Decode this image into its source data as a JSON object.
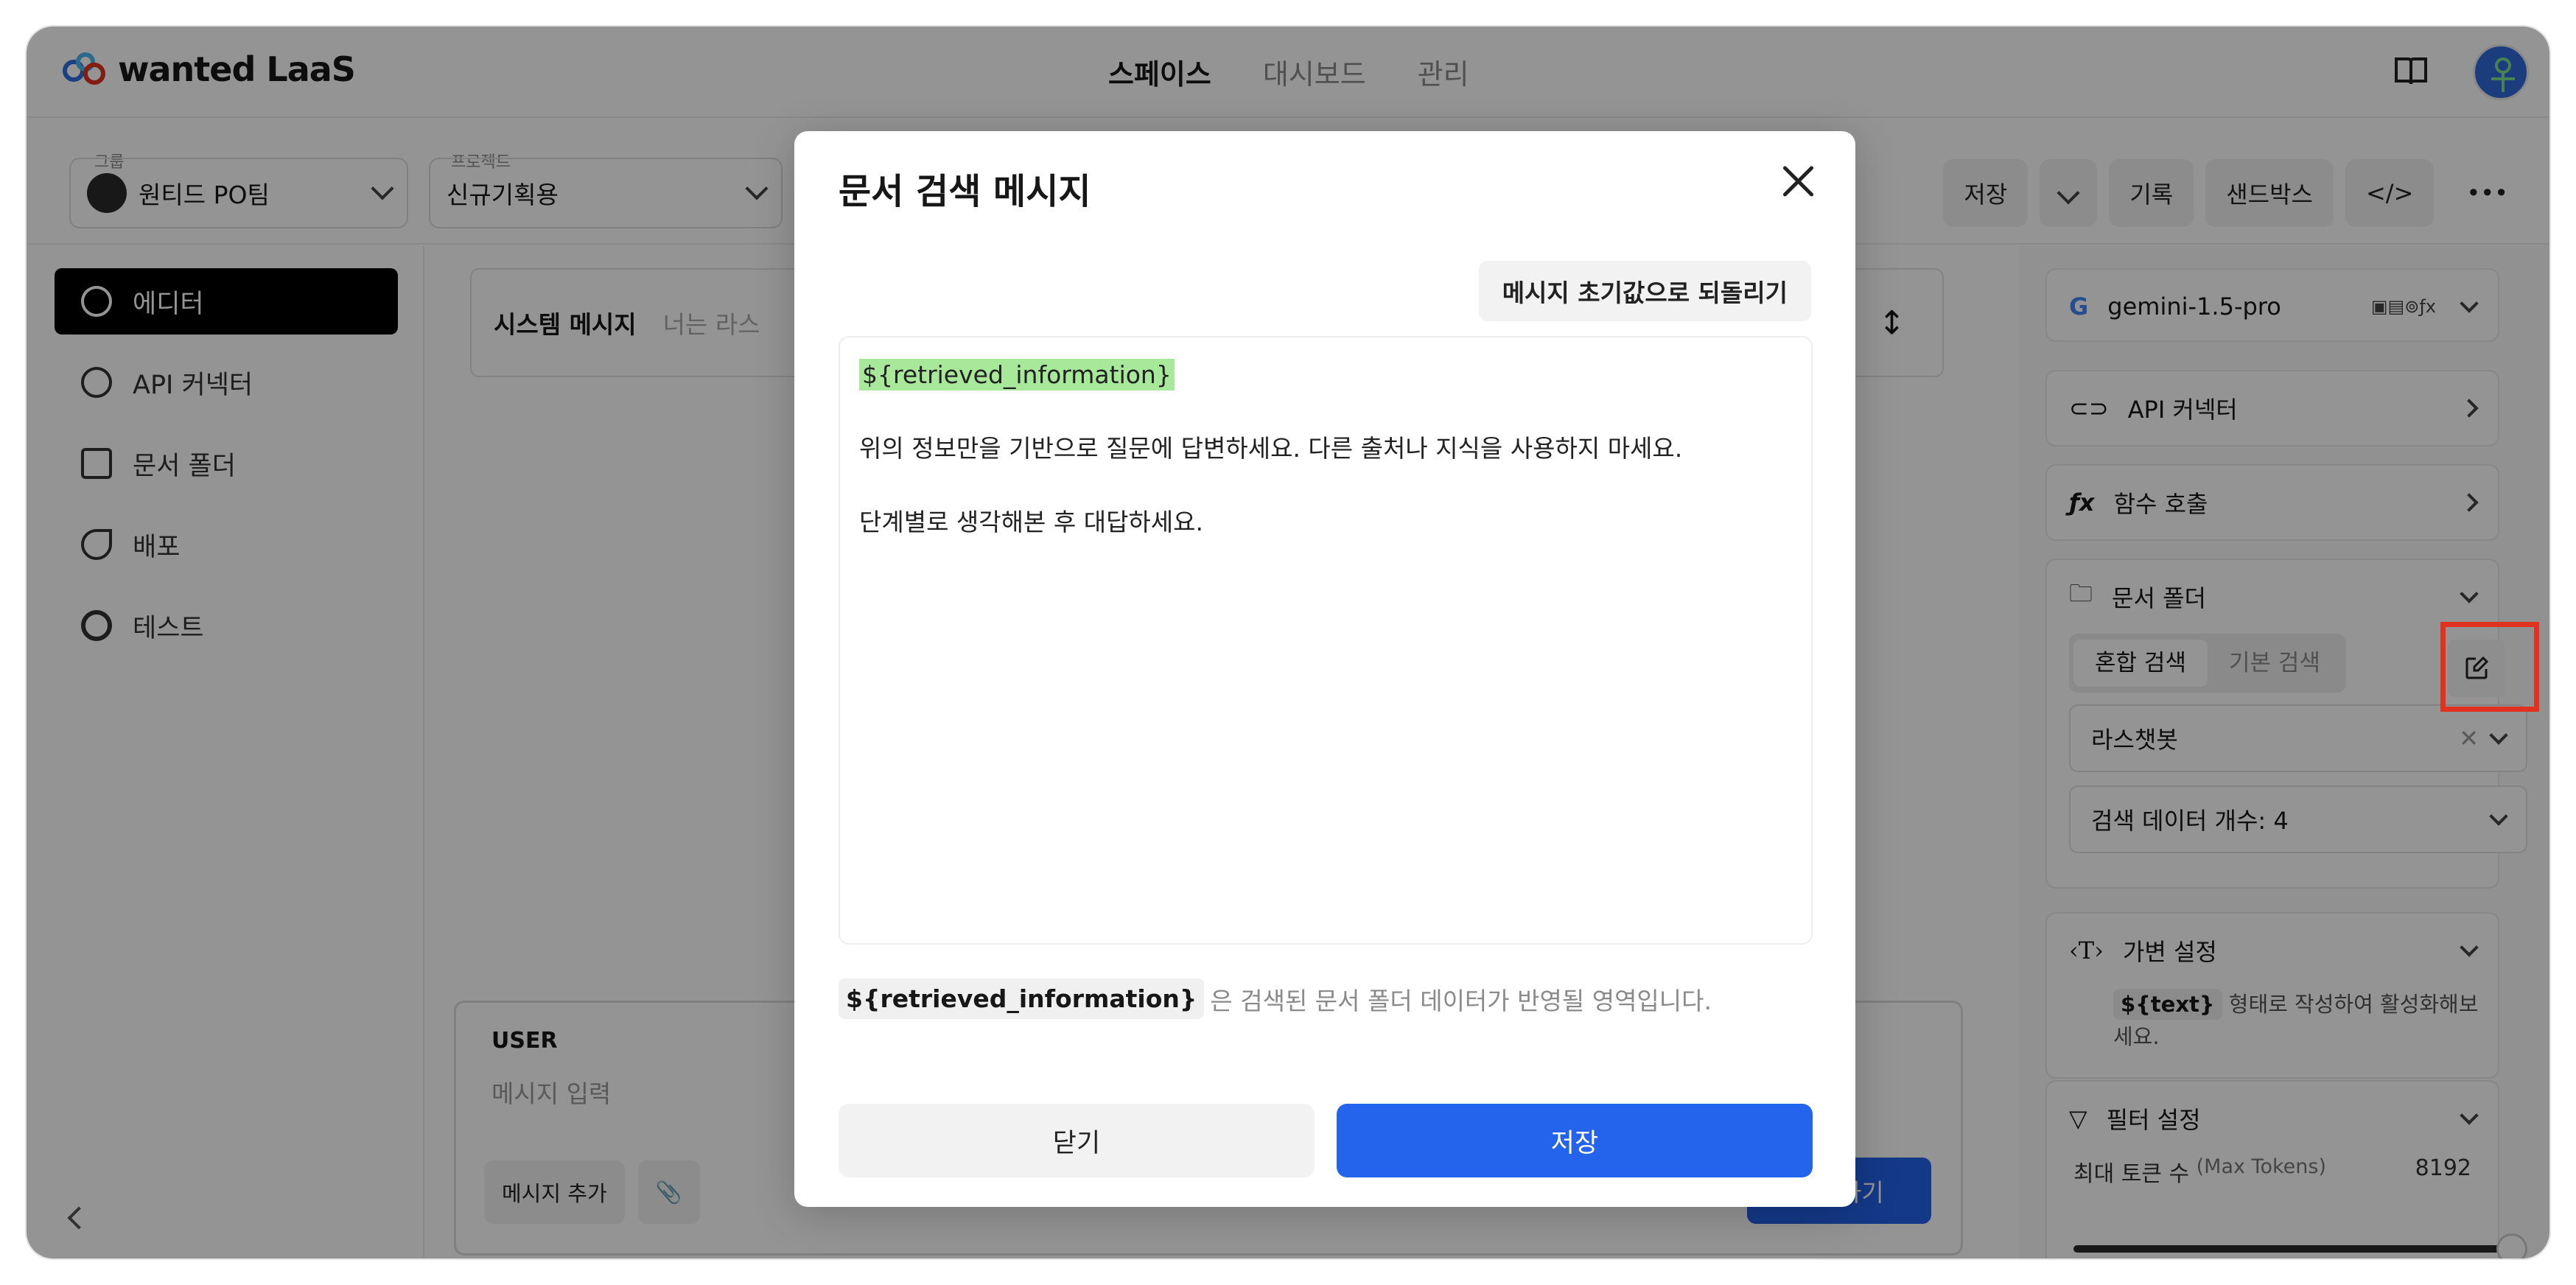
{
  "app": {
    "logo_text": "wanted LaaS"
  },
  "nav": {
    "items": [
      "스페이스",
      "대시보드",
      "관리"
    ],
    "active": 0
  },
  "subbar": {
    "group_label": "그룹",
    "group_value": "원티드 PO팀",
    "project_label": "프로젝트",
    "project_value": "신규기획용",
    "save": "저장",
    "history": "기록",
    "sandbox": "샌드박스"
  },
  "sidebar": {
    "items": [
      {
        "label": "에디터",
        "icon": "chat-icon"
      },
      {
        "label": "API 커넥터",
        "icon": "link-icon"
      },
      {
        "label": "문서 폴더",
        "icon": "folder-search-icon"
      },
      {
        "label": "배포",
        "icon": "rocket-icon"
      },
      {
        "label": "테스트",
        "icon": "target-icon"
      }
    ]
  },
  "editor": {
    "system_label": "시스템 메시지",
    "system_placeholder": "너는 라스",
    "user_title": "USER",
    "user_placeholder": "메시지 입력",
    "add_message": "메시지 추가",
    "submit": "제출하기"
  },
  "right_panel": {
    "model": "gemini-1.5-pro",
    "api_connector": "API 커넥터",
    "function_call": "함수 호출",
    "doc_folder": "문서 폴더",
    "search_modes": [
      "혼합 검색",
      "기본 검색"
    ],
    "folder_select": "라스챗봇",
    "search_count": "검색 데이터 개수: 4",
    "variable_settings": "가변 설정",
    "variable_tag": "${text}",
    "variable_hint": "형태로 작성하여 활성화해보세요.",
    "filter_settings": "필터 설정",
    "max_tokens_label": "최대 토큰 수",
    "max_tokens_en": "(Max Tokens)",
    "max_tokens_value": "8192"
  },
  "modal": {
    "title": "문서 검색 메시지",
    "reset": "메시지 초기값으로 되돌리기",
    "var_line": "${retrieved_information}",
    "line1": "위의 정보만을 기반으로 질문에 답변하세요. 다른 출처나 지식을 사용하지 마세요.",
    "line2": "단계별로 생각해본 후 대답하세요.",
    "hint_tag": "${retrieved_information}",
    "hint_text": "은 검색된 문서 폴더 데이터가 반영될 영역입니다.",
    "close": "닫기",
    "save": "저장"
  },
  "colors": {
    "primary": "#2463eb",
    "highlight": "#a7e89b",
    "annotation": "#e0321f"
  }
}
